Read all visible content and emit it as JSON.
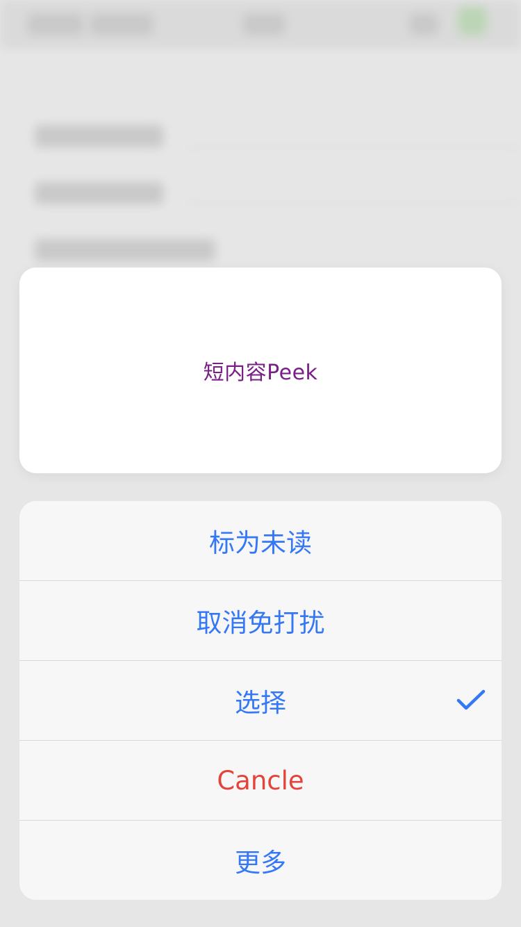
{
  "peek": {
    "text": "短内容Peek",
    "text_color": "#7a1f86"
  },
  "action_sheet": {
    "items": [
      {
        "label": "标为未读",
        "style": "default",
        "checked": false
      },
      {
        "label": "取消免打扰",
        "style": "default",
        "checked": false
      },
      {
        "label": "选择",
        "style": "default",
        "checked": true
      },
      {
        "label": "Cancle",
        "style": "destructive",
        "checked": false
      },
      {
        "label": "更多",
        "style": "default",
        "checked": false
      }
    ],
    "accent_color": "#3478f6",
    "destructive_color": "#e2443a",
    "check_icon": "checkmark-icon"
  }
}
